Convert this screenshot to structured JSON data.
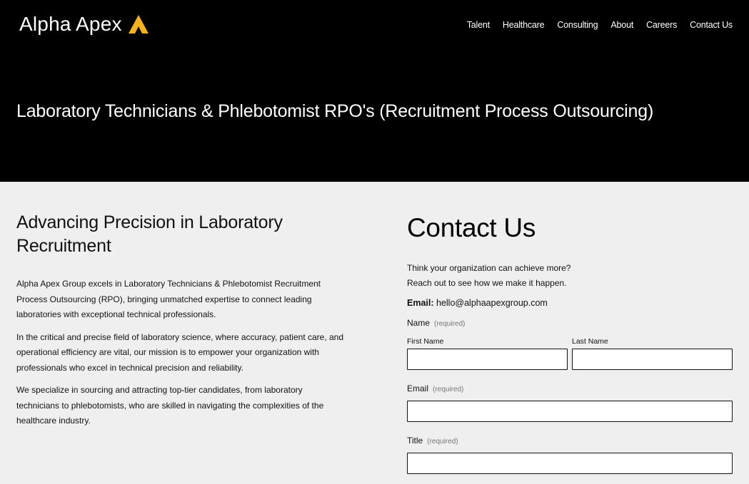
{
  "brand": {
    "name": "Alpha Apex",
    "accent_color": "#f5b21a"
  },
  "nav": {
    "items": [
      "Talent",
      "Healthcare",
      "Consulting",
      "About",
      "Careers",
      "Contact Us"
    ]
  },
  "hero": {
    "title": "Laboratory Technicians & Phlebotomist RPO's (Recruitment Process Outsourcing)"
  },
  "content": {
    "heading": "Advancing Precision in Laboratory Recruitment",
    "paragraphs": [
      "Alpha Apex Group excels in Laboratory Technicians & Phlebotomist Recruitment Process Outsourcing (RPO), bringing unmatched expertise to connect leading laboratories with exceptional technical professionals.",
      "In the critical and precise field of laboratory science, where accuracy, patient care, and operational efficiency are vital, our mission is to empower your organization with professionals who excel in technical precision and reliability.",
      "We specialize in sourcing and attracting top-tier candidates, from laboratory technicians to phlebotomists, who are skilled in navigating the complexities of the healthcare industry."
    ]
  },
  "contact": {
    "title": "Contact Us",
    "intro_line1": "Think your organization can achieve more?",
    "intro_line2": "Reach out to see how we make it happen.",
    "email_label": "Email:",
    "email_value": "hello@alphaapexgroup.com",
    "required_text": "(required)",
    "name_label": "Name",
    "first_name_label": "First Name",
    "last_name_label": "Last Name",
    "email_field_label": "Email",
    "title_field_label": "Title",
    "first_name_value": "",
    "last_name_value": "",
    "email_field_value": "",
    "title_field_value": ""
  }
}
